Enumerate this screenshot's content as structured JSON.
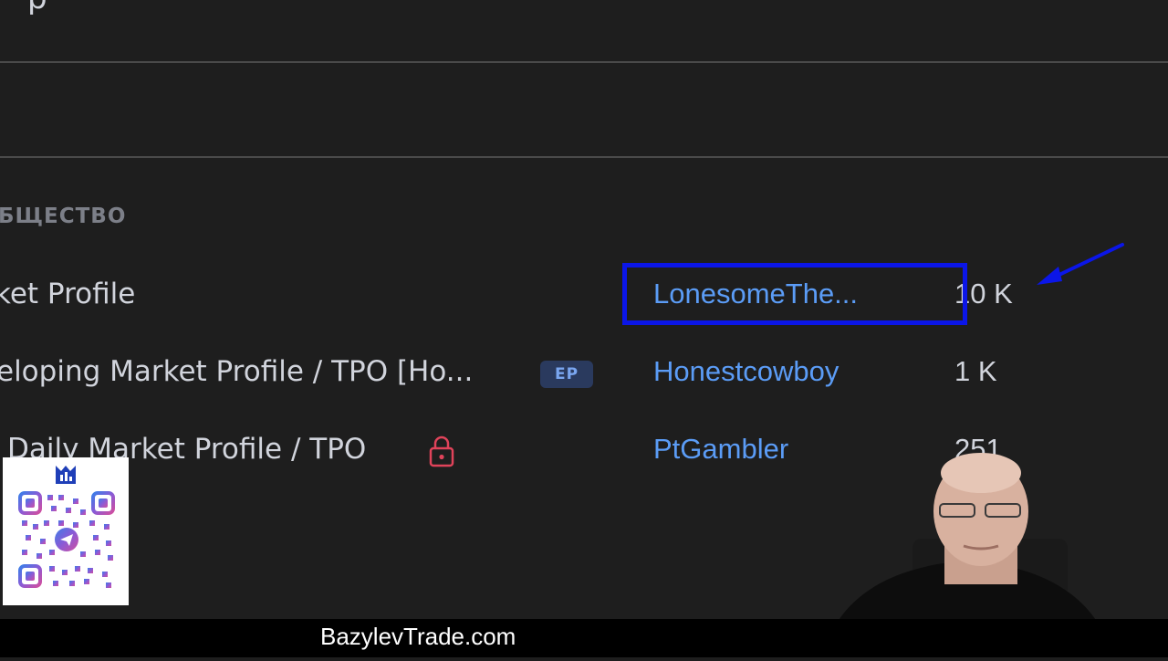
{
  "header": {
    "title_fragment": "р"
  },
  "community": {
    "section_label": "БЩЕСТВО",
    "rows": [
      {
        "name": "ket Profile",
        "author": "LonesomeThe...",
        "count": "10 K",
        "badge": "",
        "locked": false
      },
      {
        "name": "eloping Market Profile / TPO [Ho...",
        "author": "Honestcowboy",
        "count": "1 K",
        "badge": "EP",
        "locked": false
      },
      {
        "name": "Daily Market Profile / TPO",
        "author": "PtGambler",
        "count": "251",
        "badge": "",
        "locked": true
      }
    ]
  },
  "overlay": {
    "website": "BazylevTrade.com",
    "highlight_color": "#0b16e8",
    "arrow_color": "#0b16e8",
    "qr_icon": "qr-code-icon",
    "logo_icon": "chart-logo-icon"
  },
  "colors": {
    "background": "#1e1e1e",
    "author_link": "#5b9cf6",
    "lock": "#e0435a"
  }
}
